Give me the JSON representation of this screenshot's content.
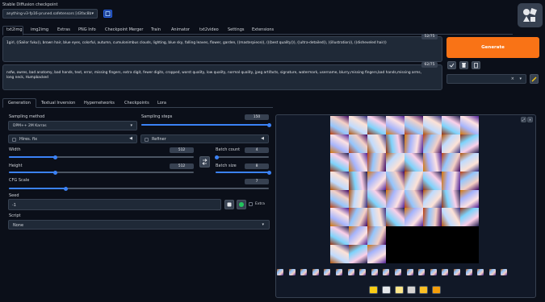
{
  "checkpoint": {
    "label": "Stable Diffusion checkpoint",
    "value": "anything-v3-fp16-pruned.safetensors [d3fac8b",
    "refresh_icon": "refresh-icon"
  },
  "tabs": [
    "txt2img",
    "img2img",
    "Extras",
    "PNG Info",
    "Checkpoint Merger",
    "Train",
    "Animator",
    "txt2video",
    "Settings",
    "Extensions"
  ],
  "active_tab": "txt2img",
  "prompt": {
    "text": "1girl, ((Sailor fuku)), brown hair, blue eyes, colorful, autumn, cumulonimbus clouds, lighting, blue sky, falling leaves, flower, garden, ((masterpiece)), (((best quality))), ((ultra-detailed)), ((illustration)), ((disheveled hair))",
    "counter": "52/75"
  },
  "negative_prompt": {
    "text": "nsfw, owres, bad anatomy, bad hands, text, error, missing fingers, extra digit, fewer digits, cropped, worst quality, low quality, normal quality, jpeg artifacts, signature, watermark, username, blurry,missing fingers,bad hands,missing arms, long neck, Humpbacked",
    "counter": "62/75"
  },
  "generate_label": "Generate",
  "style_dropdown": {
    "clear": "×",
    "arrow": "▾"
  },
  "sub_tabs": [
    "Generation",
    "Textual Inversion",
    "Hypernetworks",
    "Checkpoints",
    "Lora"
  ],
  "active_sub_tab": "Generation",
  "sampling": {
    "method_label": "Sampling method",
    "method_value": "DPM++ 2M Karras",
    "steps_label": "Sampling steps",
    "steps_value": "150",
    "steps_fraction": 1.0
  },
  "hires_label": "Hires. fix",
  "refiner_label": "Refiner",
  "width": {
    "label": "Width",
    "value": "512",
    "fraction": 0.25
  },
  "height": {
    "label": "Height",
    "value": "512",
    "fraction": 0.25
  },
  "batch_count": {
    "label": "Batch count",
    "value": "4",
    "fraction": 0.03
  },
  "batch_size": {
    "label": "Batch size",
    "value": "8",
    "fraction": 1.0
  },
  "cfg": {
    "label": "CFG Scale",
    "value": "7",
    "fraction": 0.22
  },
  "seed": {
    "label": "Seed",
    "value": "-1",
    "extra_label": "Extra"
  },
  "script": {
    "label": "Script",
    "value": "None"
  },
  "colors": {
    "accent": "#3b82f6",
    "generate": "#f97316",
    "background": "#0b0f19",
    "panel": "#1f2937"
  }
}
